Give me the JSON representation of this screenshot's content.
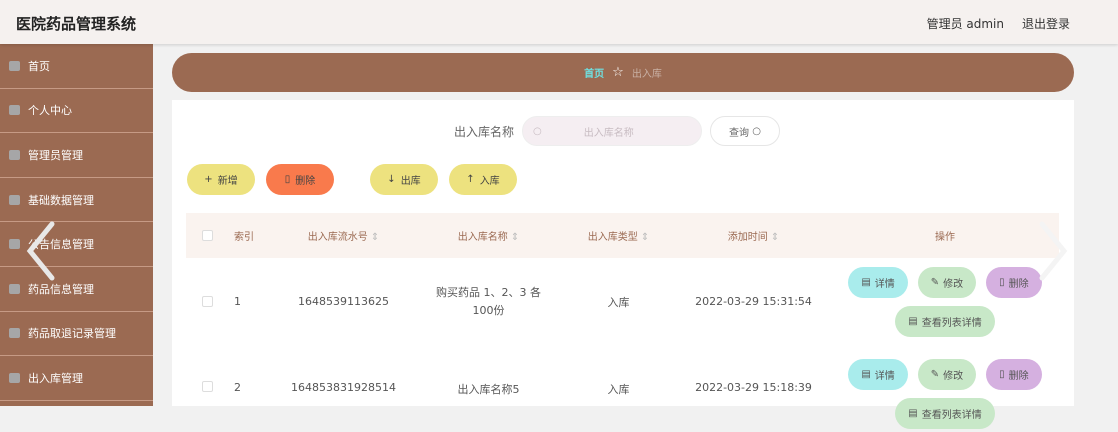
{
  "header": {
    "title": "医院药品管理系统",
    "user": "管理员 admin",
    "logout": "退出登录"
  },
  "sidebar": {
    "items": [
      {
        "label": "首页",
        "icon": "home-icon"
      },
      {
        "label": "个人中心",
        "icon": "user-icon"
      },
      {
        "label": "管理员管理",
        "icon": "admin-icon"
      },
      {
        "label": "基础数据管理",
        "icon": "data-icon"
      },
      {
        "label": "公告信息管理",
        "icon": "notice-icon"
      },
      {
        "label": "药品信息管理",
        "icon": "medicine-icon"
      },
      {
        "label": "药品取退记录管理",
        "icon": "record-icon"
      },
      {
        "label": "出入库管理",
        "icon": "warehouse-icon"
      }
    ]
  },
  "breadcrumb": {
    "home": "首页",
    "current": "出入库"
  },
  "search": {
    "label": "出入库名称",
    "placeholder": "出入库名称",
    "button": "查询"
  },
  "toolbar": {
    "add": "新增",
    "delete": "删除",
    "out": "出库",
    "in": "入库"
  },
  "table": {
    "headers": [
      "索引",
      "出入库流水号",
      "出入库名称",
      "出入库类型",
      "添加时间",
      "操作"
    ],
    "rows": [
      {
        "index": "1",
        "serial": "1648539113625",
        "name": "购买药品 1、2、3 各100份",
        "type": "入库",
        "time": "2022-03-29 15:31:54"
      },
      {
        "index": "2",
        "serial": "164853831928514",
        "name": "出入库名称5",
        "type": "入库",
        "time": "2022-03-29 15:18:39"
      }
    ],
    "actions": {
      "detail": "详情",
      "edit": "修改",
      "delete": "删除",
      "list": "查看列表详情"
    }
  }
}
